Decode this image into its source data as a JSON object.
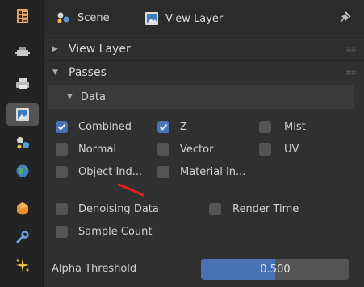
{
  "header": {
    "scene_label": "Scene",
    "view_layer_label": "View Layer"
  },
  "panels": {
    "view_layer": "View Layer",
    "passes": "Passes",
    "data": "Data"
  },
  "passes": {
    "combined": {
      "label": "Combined",
      "checked": true
    },
    "z": {
      "label": "Z",
      "checked": true
    },
    "mist": {
      "label": "Mist",
      "checked": false
    },
    "normal": {
      "label": "Normal",
      "checked": false
    },
    "vector": {
      "label": "Vector",
      "checked": false
    },
    "uv": {
      "label": "UV",
      "checked": false
    },
    "object_index": {
      "label": "Object Ind...",
      "checked": false
    },
    "material_index": {
      "label": "Material In...",
      "checked": false
    },
    "denoising_data": {
      "label": "Denoising Data",
      "checked": false
    },
    "render_time": {
      "label": "Render Time",
      "checked": false
    },
    "sample_count": {
      "label": "Sample Count",
      "checked": false
    }
  },
  "alpha_threshold": {
    "label": "Alpha Threshold",
    "value": "0.500",
    "fraction": 0.5
  },
  "colors": {
    "accent": "#4772b3",
    "annotation": "#e0201e"
  },
  "sidebar_tabs": [
    "tool-icon",
    "render-icon",
    "output-icon",
    "view-layer-icon",
    "scene-icon",
    "world-icon",
    "object-icon",
    "modifier-icon",
    "particles-icon"
  ]
}
